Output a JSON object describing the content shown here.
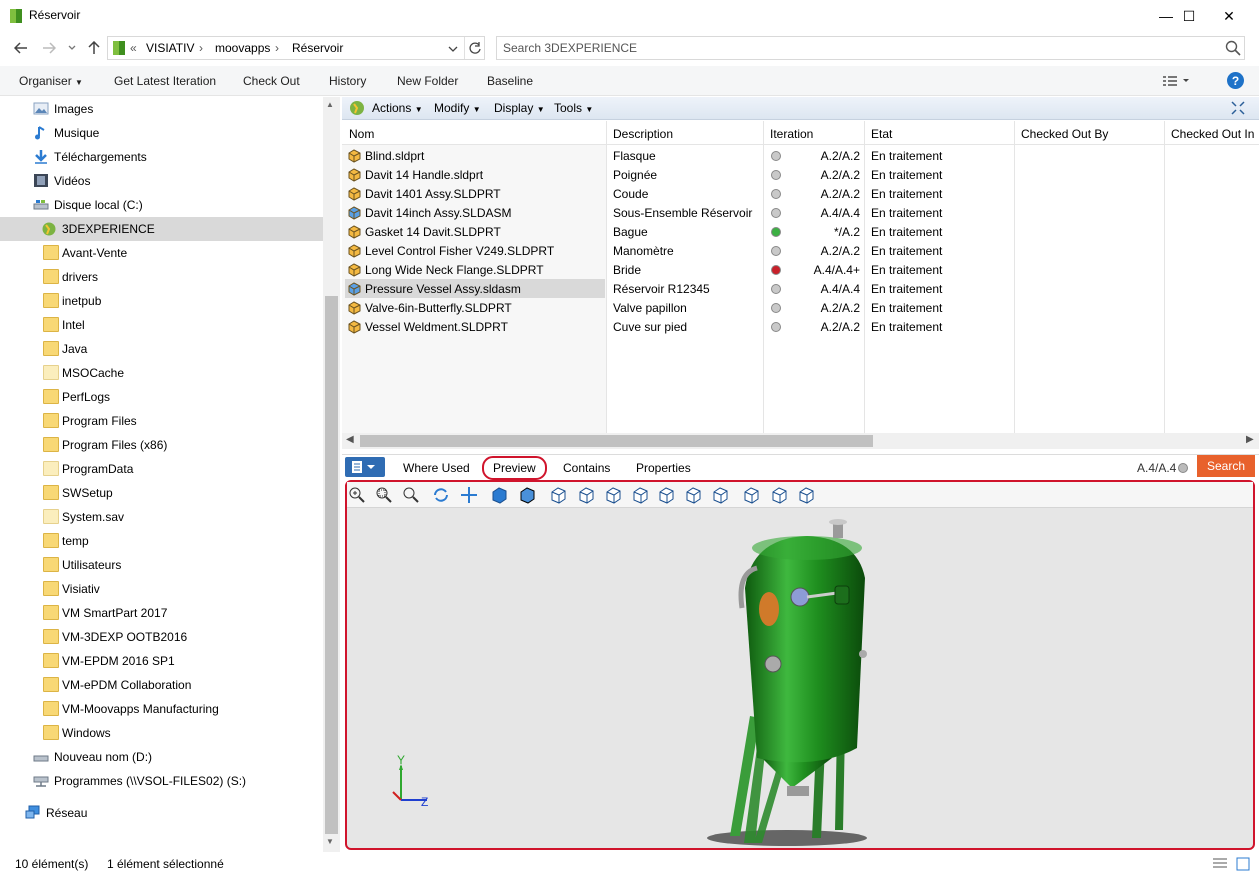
{
  "window": {
    "title": "Réservoir",
    "minimize_glyph": "—",
    "maximize_glyph": "☐",
    "close_glyph": "✕"
  },
  "address": {
    "prefix": "«",
    "crumbs": [
      "VISIATIV",
      "moovapps",
      "Réservoir"
    ],
    "separator": "›",
    "search_placeholder": "Search 3DEXPERIENCE"
  },
  "commandbar": {
    "items": [
      "Organiser",
      "Get Latest Iteration",
      "Check Out",
      "History",
      "New Folder",
      "Baseline"
    ],
    "help": "?"
  },
  "nav": {
    "items": [
      {
        "label": "Images",
        "icon": "images-icon"
      },
      {
        "label": "Musique",
        "icon": "music-icon"
      },
      {
        "label": "Téléchargements",
        "icon": "download-icon"
      },
      {
        "label": "Vidéos",
        "icon": "video-icon"
      },
      {
        "label": "Disque local (C:)",
        "icon": "drive-icon"
      },
      {
        "label": "3DEXPERIENCE",
        "icon": "3dexperience-icon"
      },
      {
        "label": "Avant-Vente",
        "icon": "folder-icon"
      },
      {
        "label": "drivers",
        "icon": "folder-icon"
      },
      {
        "label": "inetpub",
        "icon": "folder-icon"
      },
      {
        "label": "Intel",
        "icon": "folder-icon"
      },
      {
        "label": "Java",
        "icon": "folder-icon"
      },
      {
        "label": "MSOCache",
        "icon": "folder-icon"
      },
      {
        "label": "PerfLogs",
        "icon": "folder-icon"
      },
      {
        "label": "Program Files",
        "icon": "folder-icon"
      },
      {
        "label": "Program Files (x86)",
        "icon": "folder-icon"
      },
      {
        "label": "ProgramData",
        "icon": "folder-icon"
      },
      {
        "label": "SWSetup",
        "icon": "folder-icon"
      },
      {
        "label": "System.sav",
        "icon": "folder-icon"
      },
      {
        "label": "temp",
        "icon": "folder-icon"
      },
      {
        "label": "Utilisateurs",
        "icon": "folder-icon"
      },
      {
        "label": "Visiativ",
        "icon": "folder-icon"
      },
      {
        "label": "VM SmartPart 2017",
        "icon": "folder-icon"
      },
      {
        "label": "VM-3DEXP OOTB2016",
        "icon": "folder-icon"
      },
      {
        "label": "VM-EPDM 2016 SP1",
        "icon": "folder-icon"
      },
      {
        "label": "VM-ePDM Collaboration",
        "icon": "folder-icon"
      },
      {
        "label": "VM-Moovapps Manufacturing",
        "icon": "folder-icon"
      },
      {
        "label": "Windows",
        "icon": "folder-icon"
      },
      {
        "label": "Nouveau nom (D:)",
        "icon": "drive-icon"
      },
      {
        "label": "Programmes (\\\\VSOL-FILES02) (S:)",
        "icon": "network-drive-icon"
      },
      {
        "label": "Réseau",
        "icon": "network-icon"
      }
    ],
    "selected": "3DEXPERIENCE"
  },
  "actionbar": {
    "items": [
      "Actions",
      "Modify",
      "Display",
      "Tools"
    ]
  },
  "list": {
    "columns": [
      "Nom",
      "Description",
      "Iteration",
      "Etat",
      "Checked Out By",
      "Checked Out In"
    ],
    "rows": [
      {
        "name": "Blind.sldprt",
        "description": "Flasque",
        "iteration": "A.2/A.2",
        "state": "En traitement",
        "status": "neutral",
        "type": "part"
      },
      {
        "name": "Davit 14 Handle.sldprt",
        "description": "Poignée",
        "iteration": "A.2/A.2",
        "state": "En traitement",
        "status": "neutral",
        "type": "part"
      },
      {
        "name": "Davit 1401 Assy.SLDPRT",
        "description": "Coude",
        "iteration": "A.2/A.2",
        "state": "En traitement",
        "status": "neutral",
        "type": "part"
      },
      {
        "name": "Davit 14inch Assy.SLDASM",
        "description": "Sous-Ensemble Réservoir",
        "iteration": "A.4/A.4",
        "state": "En traitement",
        "status": "neutral",
        "type": "assembly"
      },
      {
        "name": "Gasket 14 Davit.SLDPRT",
        "description": "Bague",
        "iteration": "*/A.2",
        "state": "En traitement",
        "status": "new",
        "type": "part"
      },
      {
        "name": "Level Control Fisher V249.SLDPRT",
        "description": "Manomètre",
        "iteration": "A.2/A.2",
        "state": "En traitement",
        "status": "neutral",
        "type": "part"
      },
      {
        "name": "Long Wide Neck Flange.SLDPRT",
        "description": "Bride",
        "iteration": "A.4/A.4+",
        "state": "En traitement",
        "status": "outdated",
        "type": "part"
      },
      {
        "name": "Pressure Vessel Assy.sldasm",
        "description": "Réservoir R12345",
        "iteration": "A.4/A.4",
        "state": "En traitement",
        "status": "neutral",
        "type": "assembly"
      },
      {
        "name": "Valve-6in-Butterfly.SLDPRT",
        "description": "Valve papillon",
        "iteration": "A.2/A.2",
        "state": "En traitement",
        "status": "neutral",
        "type": "part"
      },
      {
        "name": "Vessel Weldment.SLDPRT",
        "description": "Cuve sur pied",
        "iteration": "A.2/A.2",
        "state": "En traitement",
        "status": "neutral",
        "type": "part"
      }
    ],
    "selected": "Pressure Vessel Assy.sldasm"
  },
  "tabs": {
    "items": [
      "Where Used",
      "Preview",
      "Contains",
      "Properties"
    ],
    "active": "Preview",
    "iteration_label": "A.4/A.4",
    "search_button": "Search"
  },
  "preview": {
    "axis_y": "Y",
    "axis_z": "Z",
    "tools": [
      "zoom-in-icon",
      "zoom-area-icon",
      "zoom-fit-icon",
      "rotate-icon",
      "pan-icon",
      "shaded-icon",
      "shaded-edges-icon",
      "view-front-icon",
      "view-back-icon",
      "view-left-icon",
      "view-right-icon",
      "view-top-icon",
      "view-bottom-icon",
      "view-iso-icon",
      "measure-icon",
      "select-icon",
      "print-icon"
    ]
  },
  "status": {
    "count": "10 élément(s)",
    "selection": "1 élément sélectionné"
  },
  "colors": {
    "accent": "#e8612c",
    "highlight_border": "#d0142c",
    "vessel_green": "#1f8f1f",
    "selected_bg": "#d9d9d9"
  }
}
